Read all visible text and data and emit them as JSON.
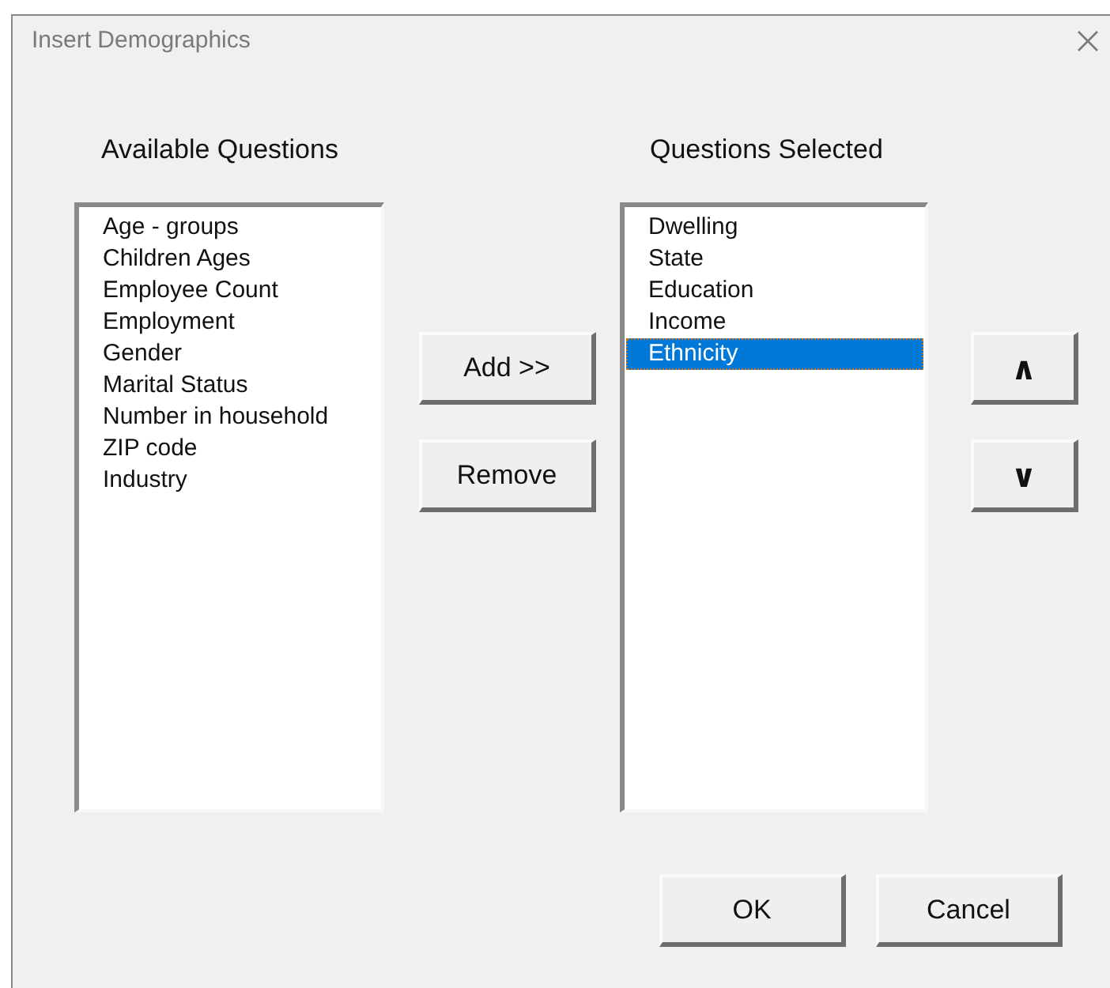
{
  "window": {
    "title": "Insert Demographics"
  },
  "available": {
    "label": "Available Questions",
    "items": [
      {
        "text": "Age - groups",
        "selected": false
      },
      {
        "text": "Children Ages",
        "selected": false
      },
      {
        "text": "Employee Count",
        "selected": false
      },
      {
        "text": "Employment",
        "selected": false
      },
      {
        "text": "Gender",
        "selected": false
      },
      {
        "text": "Marital Status",
        "selected": false
      },
      {
        "text": "Number in household",
        "selected": false
      },
      {
        "text": "ZIP code",
        "selected": false
      },
      {
        "text": "Industry",
        "selected": false
      }
    ]
  },
  "chosen": {
    "label": "Questions Selected",
    "items": [
      {
        "text": "Dwelling",
        "selected": false
      },
      {
        "text": "State",
        "selected": false
      },
      {
        "text": "Education",
        "selected": false
      },
      {
        "text": "Income",
        "selected": false
      },
      {
        "text": "Ethnicity",
        "selected": true
      }
    ]
  },
  "transfer_buttons": [
    "Add >>",
    "Remove"
  ],
  "order_buttons": [
    "∧",
    "∨"
  ],
  "dialog_buttons": [
    "OK",
    "Cancel"
  ]
}
